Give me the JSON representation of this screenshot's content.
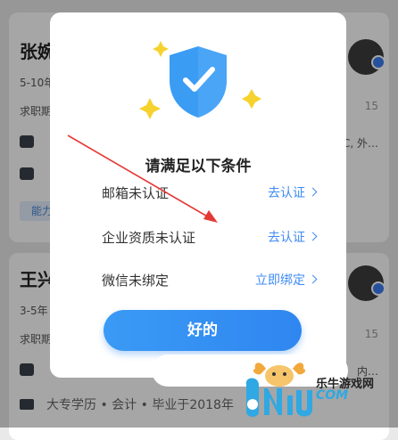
{
  "background": {
    "card1": {
      "name": "张婉",
      "experience": "5-10年",
      "job_intent": "求职期望",
      "right_time": "15",
      "right_line": "C, 外…",
      "tag": "能力"
    },
    "card2": {
      "name": "王兴",
      "experience": "3-5年",
      "job_intent": "求职期望",
      "right_time": "15",
      "right_line": "内…",
      "education_line": "大专学历 • 会计 • 毕业于2018年"
    }
  },
  "dialog": {
    "title": "请满足以下条件",
    "conditions": [
      {
        "label": "邮箱未认证",
        "action": "去认证"
      },
      {
        "label": "企业资质未认证",
        "action": "去认证"
      },
      {
        "label": "微信未绑定",
        "action": "立即绑定"
      }
    ],
    "ok_label": "好的"
  },
  "watermark": {
    "logo_text": "6NiU",
    "site_cn": "乐牛游戏网",
    "site_en": "COM"
  },
  "colors": {
    "accent": "#3f8bf5",
    "shield": "#3b9cf4",
    "star": "#f5d22e",
    "arrow": "#e53935"
  }
}
